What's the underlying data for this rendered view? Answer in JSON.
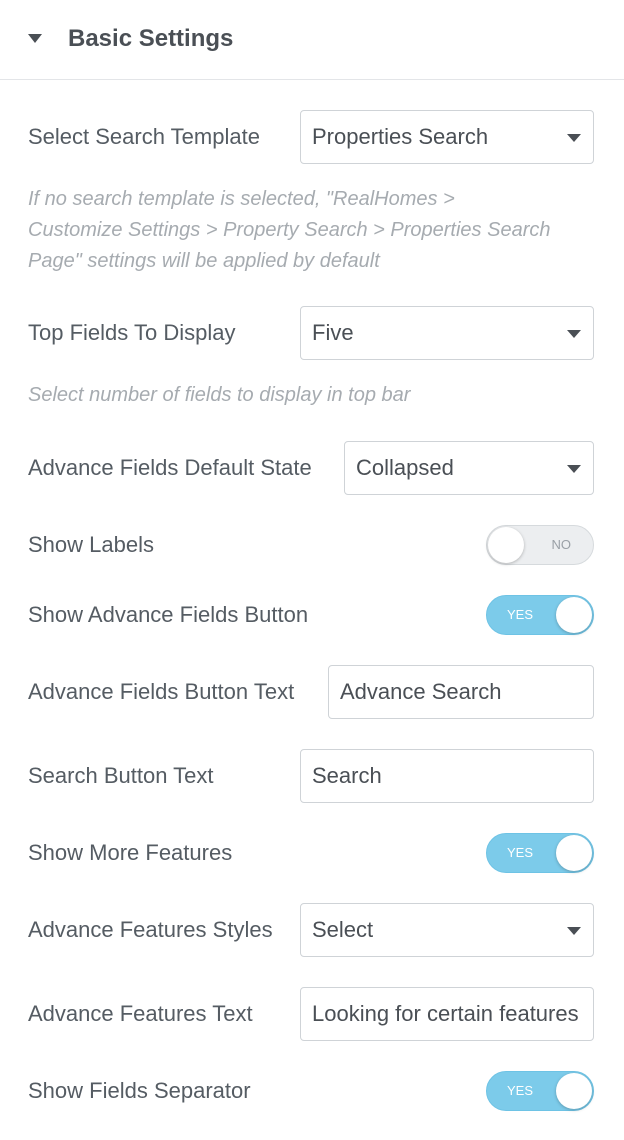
{
  "section": {
    "title": "Basic Settings"
  },
  "fields": {
    "search_template": {
      "label": "Select Search Template",
      "value": "Properties Search",
      "description": [
        "If no search template is selected, \"RealHomes >",
        "Customize Settings > Property Search > Properties Search",
        "Page\" settings will be applied by default"
      ]
    },
    "top_fields": {
      "label": "Top Fields To Display",
      "value": "Five",
      "description": "Select number of fields to display in top bar"
    },
    "advance_default_state": {
      "label": "Advance Fields Default State",
      "value": "Collapsed"
    },
    "show_labels": {
      "label": "Show Labels",
      "state": "NO"
    },
    "show_advance_button": {
      "label": "Show Advance Fields Button",
      "state": "YES"
    },
    "advance_button_text": {
      "label": "Advance Fields Button Text",
      "value": "Advance Search"
    },
    "search_button_text": {
      "label": "Search Button Text",
      "value": "Search"
    },
    "show_more_features": {
      "label": "Show More Features",
      "state": "YES"
    },
    "advance_features_styles": {
      "label": "Advance Features Styles",
      "value": "Select"
    },
    "advance_features_text": {
      "label": "Advance Features Text",
      "value": "Looking for certain features"
    },
    "show_fields_separator": {
      "label": "Show Fields Separator",
      "state": "YES"
    }
  },
  "colors": {
    "toggle_on": "#7ccbea",
    "toggle_off": "#eceef0",
    "label": "#555c63",
    "description": "#a6abb0"
  }
}
